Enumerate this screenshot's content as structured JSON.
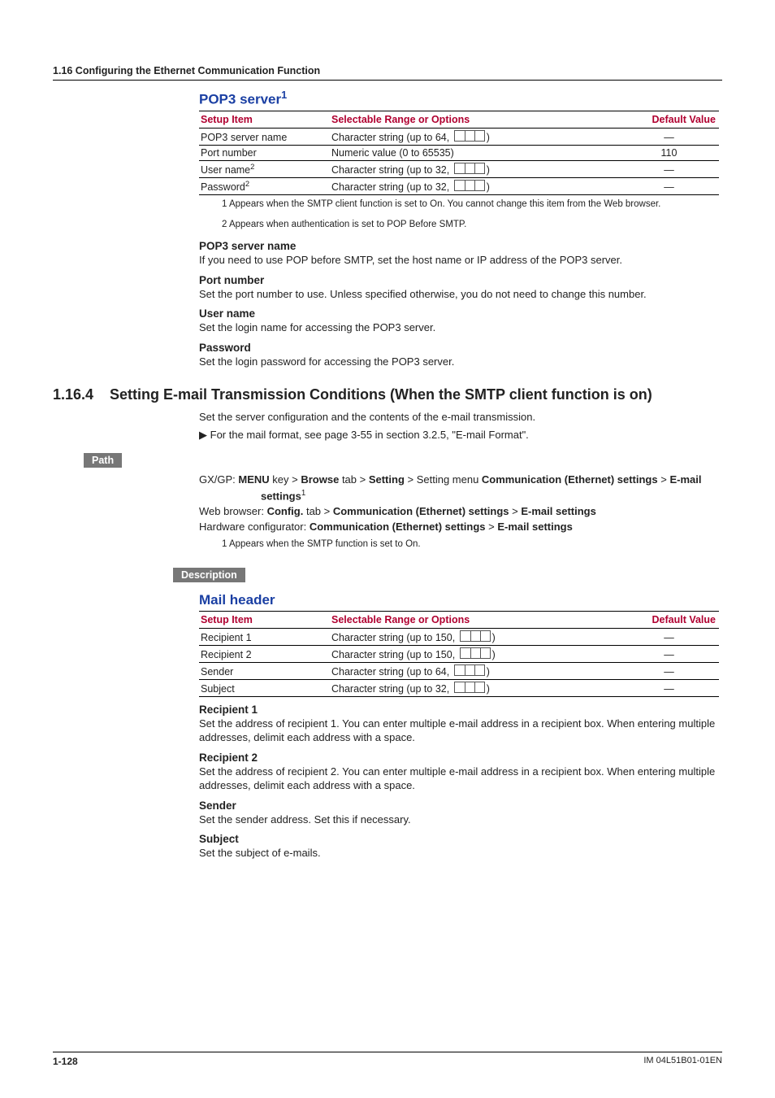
{
  "running_head": "1.16  Configuring the Ethernet Communication Function",
  "pop3": {
    "title_html": "POP3 server",
    "title_sup": "1",
    "table": {
      "cols": [
        "Setup Item",
        "Selectable Range or Options",
        "Default Value"
      ],
      "rows": [
        {
          "item": "POP3 server name",
          "range_prefix": "Character string (up to 64, ",
          "range_suffix": ")",
          "default": "—"
        },
        {
          "item": "Port number",
          "range_plain": "Numeric value (0 to 65535)",
          "default": "110"
        },
        {
          "item_html": "User name",
          "item_sup": "2",
          "range_prefix": "Character string (up to 32, ",
          "range_suffix": ")",
          "default": "—"
        },
        {
          "item_html": "Password",
          "item_sup": "2",
          "range_prefix": "Character string (up to 32, ",
          "range_suffix": ")",
          "default": "—"
        }
      ]
    },
    "footnotes": [
      "1  Appears when the SMTP client function is set to On. You cannot change this item from the Web browser.",
      "2  Appears when authentication is set to POP Before SMTP."
    ],
    "expl": [
      {
        "head": "POP3 server name",
        "body": "If you need to use POP before SMTP, set the host name or IP address of the POP3 server."
      },
      {
        "head": "Port number",
        "body": "Set the port number to use. Unless specified otherwise, you do not need to change this number."
      },
      {
        "head": "User name",
        "body": "Set the login name for accessing the POP3 server."
      },
      {
        "head": "Password",
        "body": "Set the login password for accessing the POP3 server."
      }
    ]
  },
  "section": {
    "number": "1.16.4",
    "title": "Setting E-mail Transmission Conditions (When the SMTP client function is on)",
    "intro1": "Set the server configuration and the contents of the e-mail transmission.",
    "intro2_marker": "▶",
    "intro2": "For the mail format, see page 3-55 in section 3.2.5, \"E-mail Format\".",
    "path_label": "Path",
    "path_gx_prefix": "GX/GP: ",
    "path_gx": "MENU key > Browse tab > Setting > Setting menu Communication (Ethernet) settings > E-mail settings",
    "path_gx_sup": "1",
    "path_web_prefix": "Web browser: ",
    "path_web": "Config. tab > Communication (Ethernet) settings > E-mail settings",
    "path_hw_prefix": "Hardware configurator: ",
    "path_hw": "Communication (Ethernet) settings > E-mail settings",
    "path_footnote": "1  Appears when the SMTP function is set to On.",
    "desc_label": "Description"
  },
  "mail": {
    "title": "Mail header",
    "table": {
      "cols": [
        "Setup Item",
        "Selectable Range or Options",
        "Default Value"
      ],
      "rows": [
        {
          "item": "Recipient 1",
          "range_prefix": "Character string (up to 150, ",
          "range_suffix": ")",
          "default": "—"
        },
        {
          "item": "Recipient 2",
          "range_prefix": "Character string (up to 150, ",
          "range_suffix": ")",
          "default": "—"
        },
        {
          "item": "Sender",
          "range_prefix": "Character string (up to 64, ",
          "range_suffix": ")",
          "default": "—"
        },
        {
          "item": "Subject",
          "range_prefix": "Character string (up to 32, ",
          "range_suffix": ")",
          "default": "—"
        }
      ]
    },
    "expl": [
      {
        "head": "Recipient 1",
        "body": "Set the address of recipient 1. You can enter multiple e-mail address in a recipient box. When entering multiple addresses, delimit each address with a space."
      },
      {
        "head": "Recipient 2",
        "body": "Set the address of recipient 2. You can enter multiple e-mail address in a recipient box. When entering multiple addresses, delimit each address with a space."
      },
      {
        "head": "Sender",
        "body": "Set the sender address. Set this if necessary."
      },
      {
        "head": "Subject",
        "body": "Set the subject of e-mails."
      }
    ]
  },
  "footer": {
    "page": "1-128",
    "doc": "IM 04L51B01-01EN"
  },
  "chart_data": {
    "type": "table",
    "tables": [
      {
        "title": "POP3 server",
        "columns": [
          "Setup Item",
          "Selectable Range or Options",
          "Default Value"
        ],
        "rows": [
          [
            "POP3 server name",
            "Character string (up to 64)",
            "—"
          ],
          [
            "Port number",
            "Numeric value (0 to 65535)",
            "110"
          ],
          [
            "User name",
            "Character string (up to 32)",
            "—"
          ],
          [
            "Password",
            "Character string (up to 32)",
            "—"
          ]
        ]
      },
      {
        "title": "Mail header",
        "columns": [
          "Setup Item",
          "Selectable Range or Options",
          "Default Value"
        ],
        "rows": [
          [
            "Recipient 1",
            "Character string (up to 150)",
            "—"
          ],
          [
            "Recipient 2",
            "Character string (up to 150)",
            "—"
          ],
          [
            "Sender",
            "Character string (up to 64)",
            "—"
          ],
          [
            "Subject",
            "Character string (up to 32)",
            "—"
          ]
        ]
      }
    ]
  }
}
